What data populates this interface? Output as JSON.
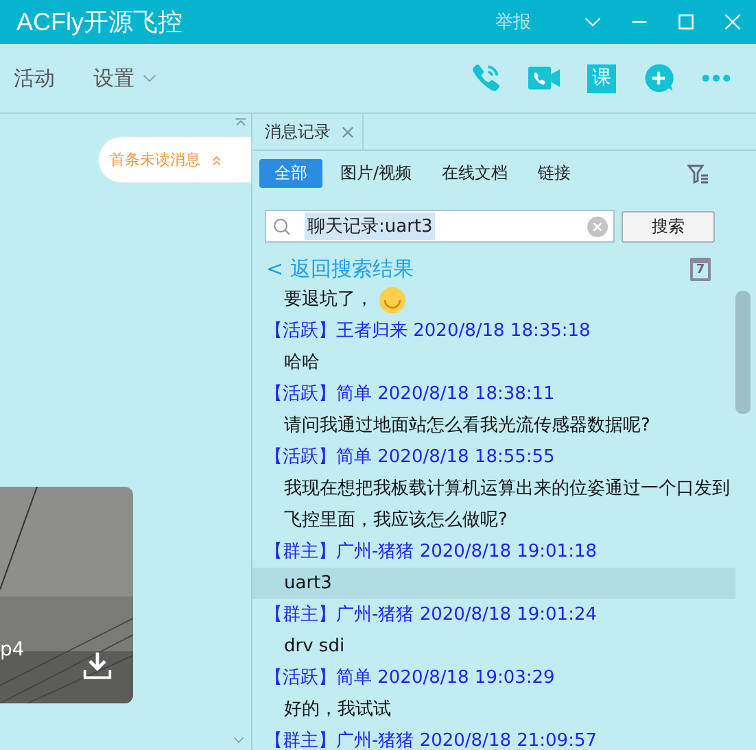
{
  "window": {
    "title": "ACFly开源飞控",
    "report": "举报"
  },
  "toolbar": {
    "items": [
      {
        "label": "活动",
        "dropdown": false
      },
      {
        "label": "设置",
        "dropdown": true
      }
    ],
    "course_label": "课"
  },
  "unread_badge": "首条未读消息",
  "video": {
    "filename": "p4"
  },
  "panel": {
    "tab": "消息记录",
    "filters": [
      {
        "label": "全部",
        "selected": true
      },
      {
        "label": "图片/视频",
        "selected": false
      },
      {
        "label": "在线文档",
        "selected": false
      },
      {
        "label": "链接",
        "selected": false
      }
    ],
    "search": {
      "value": "聊天记录:uart3",
      "value_selected": true,
      "button": "搜索"
    },
    "back_link": "< 返回搜索结果",
    "calendar_day": "7"
  },
  "messages": [
    {
      "text": "要退坑了，",
      "emoji": true,
      "selected": false
    },
    {
      "header": "【活跃】王者归来 2020/8/18 18:35:18",
      "text": "哈哈",
      "selected": false
    },
    {
      "header": "【活跃】简单 2020/8/18 18:38:11",
      "text": "请问我通过地面站怎么看我光流传感器数据呢?",
      "selected": false
    },
    {
      "header": "【活跃】简单 2020/8/18 18:55:55",
      "text": "我现在想把我板载计算机运算出来的位姿通过一个口发到飞控里面，我应该怎么做呢?",
      "selected": false
    },
    {
      "header": "【群主】广州-猪猪 2020/8/18 19:01:18",
      "text": "uart3",
      "selected": true
    },
    {
      "header": "【群主】广州-猪猪 2020/8/18 19:01:24",
      "text": "drv sdi",
      "selected": false
    },
    {
      "header": "【活跃】简单 2020/8/18 19:03:29",
      "text": "好的，我试试",
      "selected": false
    },
    {
      "header": "【群主】广州-猪猪 2020/8/18 21:09:57",
      "selected": false
    }
  ]
}
